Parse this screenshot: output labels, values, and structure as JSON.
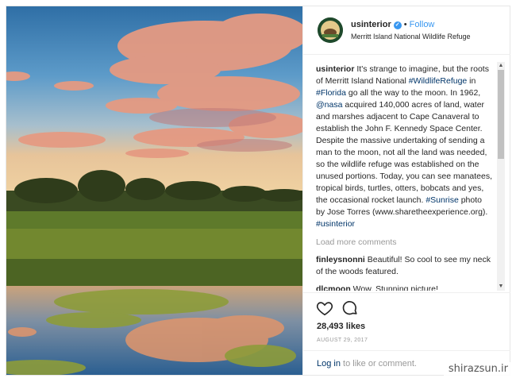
{
  "header": {
    "username": "usinterior",
    "separator": "•",
    "follow_label": "Follow",
    "location": "Merritt Island National Wildlife Refuge",
    "verified_glyph": "✓"
  },
  "caption": {
    "username": "usinterior",
    "text_1": " It's strange to imagine, but the roots of Merritt Island National ",
    "tag_1": "#WildlifeRefuge",
    "text_2": " in ",
    "tag_2": "#Florida",
    "text_3": " go all the way to the moon. In 1962, ",
    "tag_3": "@nasa",
    "text_4": " acquired 140,000 acres of land, water and marshes adjacent to Cape Canaveral to establish the John F. Kennedy Space Center. Despite the massive undertaking of sending a man to the moon, not all the land was needed, so the wildlife refuge was established on the unused portions. Today, you can see manatees, tropical birds, turtles, otters, bobcats and yes, the occasional rocket launch. ",
    "tag_4": "#Sunrise",
    "text_5": " photo by Jose Torres (www.sharetheexperience.org). ",
    "tag_5": "#usinterior"
  },
  "load_more": "Load more comments",
  "comments": [
    {
      "username": "finleysnonni",
      "text": " Beautiful! So cool to see my neck of the woods featured."
    },
    {
      "username": "dlcmoon",
      "text": " Wow. Stunning picture!"
    }
  ],
  "actions": {
    "like_icon": "heart-icon",
    "comment_icon": "comment-icon",
    "likes": "28,493 likes",
    "date": "AUGUST 29, 2017"
  },
  "login": {
    "link": "Log in",
    "rest": " to like or comment."
  },
  "watermark": "shirazsun.ir"
}
